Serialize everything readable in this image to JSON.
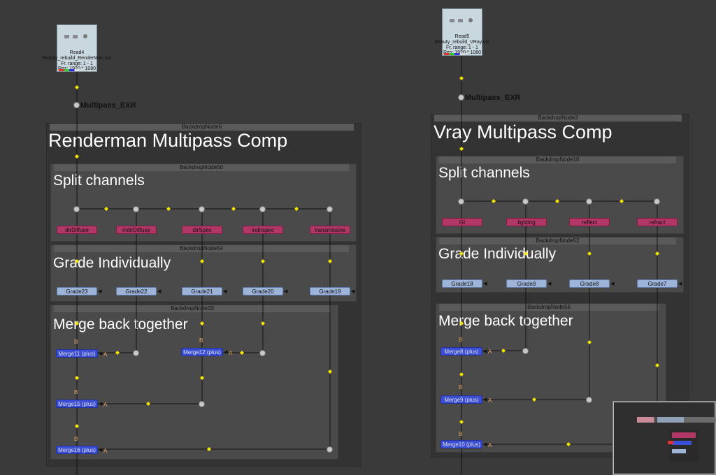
{
  "left": {
    "read_node": {
      "name": "Read4",
      "file": "Beauty_rebuild_RenderMan.exr",
      "frame_range": "Fr. range: 1 - 1",
      "resolution": "Res: 1920 * 1080"
    },
    "dot_label": "Multipass_EXR",
    "backdrops": {
      "outer": {
        "bar": "BackdropNode6",
        "title": "Renderman Multipass Comp"
      },
      "split": {
        "bar": "BackdropNode50",
        "title": "Split channels"
      },
      "grade": {
        "bar": "BackdropNode54",
        "title": "Grade Individually"
      },
      "merge": {
        "bar": "BackdropNode33",
        "title": "Merge back together"
      }
    },
    "shuffles": [
      "dirDiffuse",
      "indirDiffuse",
      "dirSpec",
      "indirspec",
      "transmissive"
    ],
    "grades": [
      "Grade23",
      "Grade22",
      "Grade21",
      "Grade20",
      "Grade19"
    ],
    "merges": [
      "Merge11 (plus)",
      "Merge12 (plus)",
      "Merge15 (plus)",
      "Merge16 (plus)"
    ]
  },
  "right": {
    "read_node": {
      "name": "Read5",
      "file": "Beauty_rebuild_VRay.exr",
      "frame_range": "Fr. range: 1 - 1",
      "resolution": "Res: 1920 * 1080"
    },
    "dot_label": "Multipass_EXR",
    "backdrops": {
      "outer": {
        "bar": "BackdropNode3",
        "title": "Vray Multipass Comp"
      },
      "split": {
        "bar": "BackdropNode10",
        "title": "Split channels"
      },
      "grade": {
        "bar": "BackdropNode52",
        "title": "Grade Individually"
      },
      "merge": {
        "bar": "BackdropNode56",
        "title": "Merge back together"
      }
    },
    "shuffles": [
      "GI",
      "lighting",
      "reflect",
      "refract"
    ],
    "grades": [
      "Grade18",
      "Grade9",
      "Grade8",
      "Grade7"
    ],
    "merges": [
      "Merge8 (plus)",
      "Merge9 (plus)",
      "Merge10 (plus)"
    ]
  },
  "input_labels": {
    "a": "A",
    "b": "B"
  }
}
